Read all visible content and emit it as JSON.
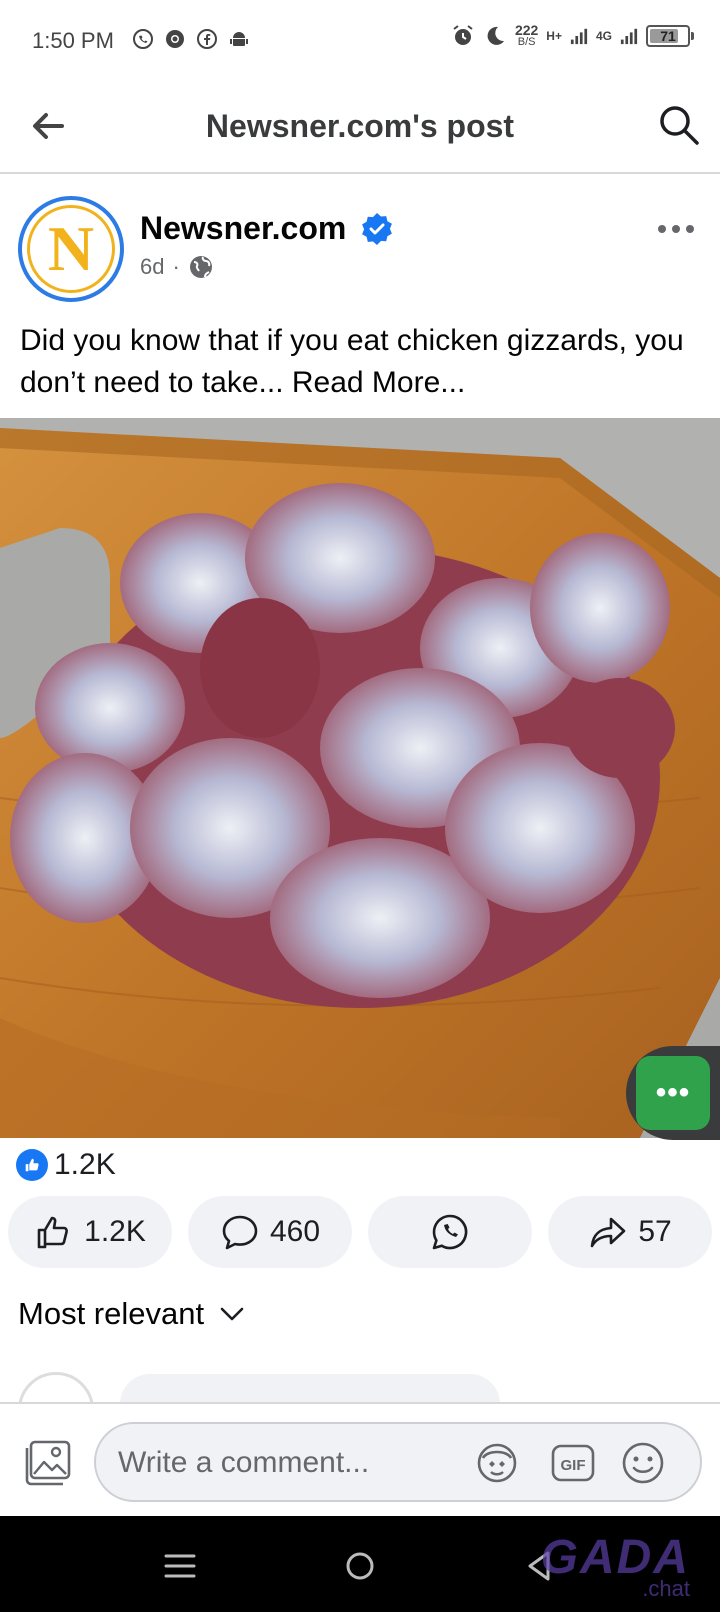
{
  "status_bar": {
    "time": "1:50 PM",
    "speed_value": "222",
    "speed_unit": "B/S",
    "net_a": "H+",
    "net_b": "4G",
    "battery": "71",
    "icons": [
      "whatsapp-icon",
      "chrome-icon",
      "facebook-icon",
      "android-icon",
      "alarm-icon",
      "moon-icon"
    ]
  },
  "header": {
    "title": "Newsner.com's post",
    "back_icon": "back-arrow-icon",
    "search_icon": "search-icon"
  },
  "post": {
    "page_name": "Newsner.com",
    "avatar_letter": "N",
    "age": "6d",
    "separator": "·",
    "text": "Did you know that if you eat chicken gizzards, you don’t need to take",
    "ellipsis": "...",
    "read_more": " Read More..."
  },
  "reactions": {
    "total": "1.2K",
    "like_count": "1.2K",
    "comment_count": "460",
    "share_count": "57"
  },
  "comments": {
    "sort_label": "Most relevant",
    "input_placeholder": "Write a comment..."
  },
  "watermark": {
    "brand": "GADA",
    "sub": ".chat"
  },
  "colors": {
    "facebook_blue": "#1877f2",
    "chat_green": "#31a24c",
    "button_bg": "#f0f2f5",
    "board_wood": "#c47c2a"
  }
}
